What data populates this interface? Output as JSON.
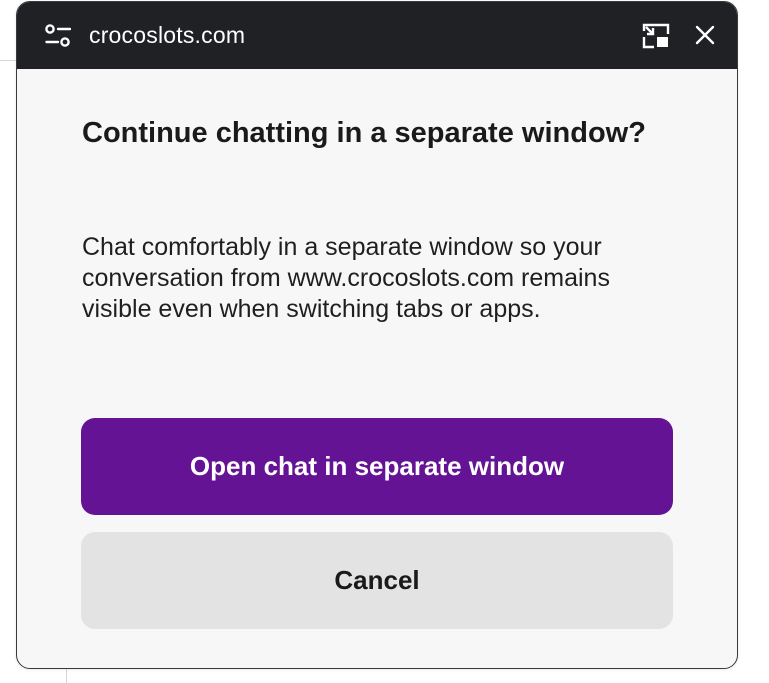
{
  "titlebar": {
    "site_name": "crocoslots.com",
    "site_icon": "settings-sliders-icon",
    "pip_icon": "picture-in-picture-icon",
    "close_icon": "close-icon"
  },
  "dialog": {
    "heading": "Continue chatting in a separate window?",
    "body": "Chat comfortably in a separate window so your conversation from www.crocoslots.com remains visible even when switching tabs or apps.",
    "primary_button": "Open chat in separate window",
    "secondary_button": "Cancel"
  },
  "colors": {
    "titlebar_bg": "#202124",
    "dialog_bg": "#f7f7f7",
    "primary_button_bg": "#631394",
    "secondary_button_bg": "#e3e3e3"
  }
}
